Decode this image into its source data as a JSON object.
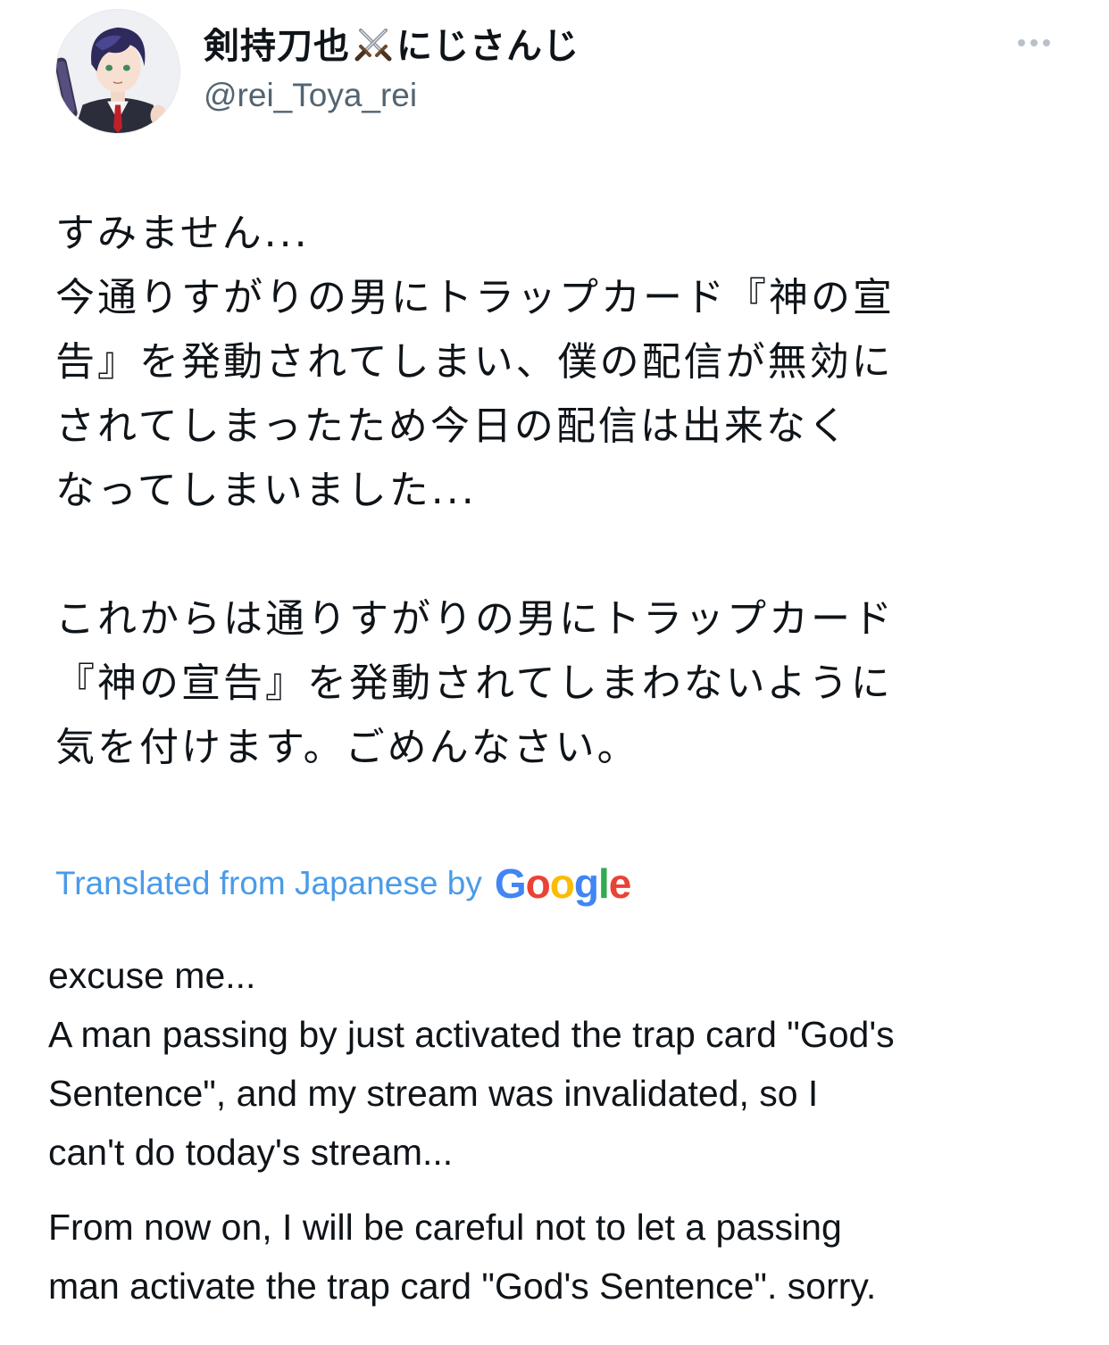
{
  "author": {
    "display_name_prefix": "剣持刀也",
    "display_name_suffix": "にじさんじ",
    "handle": "@rei_Toya_rei"
  },
  "icons": {
    "more": "more-horizontal-icon",
    "swords": "crossed-swords-icon",
    "avatar": "avatar-image"
  },
  "tweet": {
    "original_text": "すみません...\n今通りすがりの男にトラップカード『神の宣\n告』を発動されてしまい、僕の配信が無効に\nされてしまったため今日の配信は出来なく\nなってしまいました...\n\nこれからは通りすがりの男にトラップカード\n『神の宣告』を発動されてしまわないように\n気を付けます。ごめんなさい。",
    "translation_label": "Translated from Japanese by",
    "translation_provider": "Google",
    "translated_paragraphs": [
      "excuse me...\nA man passing by just activated the trap card \"God's\nSentence\", and my stream was invalidated, so I\ncan't do today's stream...",
      "From now on, I will be careful not to let a passing\nman activate the trap card \"God's Sentence\". sorry."
    ]
  },
  "colors": {
    "text": "#0f1419",
    "secondary_text": "#536471",
    "translation_link": "#4a9be8",
    "google_blue": "#4285F4",
    "google_red": "#EA4335",
    "google_yellow": "#FBBC05",
    "google_green": "#34A853"
  }
}
